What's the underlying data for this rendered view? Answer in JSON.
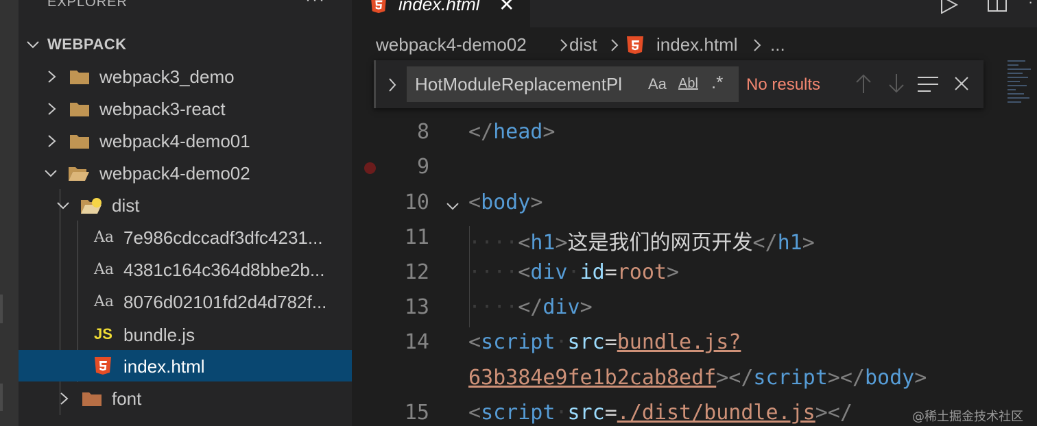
{
  "sidebar": {
    "title": "EXPLORER",
    "more": "···",
    "section": "WEBPACK",
    "items": [
      {
        "label": "webpack3_demo"
      },
      {
        "label": "webpack3-react"
      },
      {
        "label": "webpack4-demo01"
      },
      {
        "label": "webpack4-demo02"
      },
      {
        "label": "dist"
      },
      {
        "label": "7e986cdccadf3dfc4231..."
      },
      {
        "label": "4381c164c364d8bbe2b..."
      },
      {
        "label": "8076d02101fd2d4d782f..."
      },
      {
        "label": "bundle.js"
      },
      {
        "label": "index.html"
      },
      {
        "label": "font"
      }
    ],
    "font_icon_text": "Aa",
    "js_icon_text": "JS"
  },
  "editor": {
    "tab": {
      "label": "index.html",
      "close": "✕"
    },
    "breadcrumb": [
      "webpack4-demo02",
      "dist",
      "index.html",
      "..."
    ],
    "find": {
      "query": "HotModuleReplacementPl",
      "match_case": "Aa",
      "whole_word": "Abl",
      "regex": ".*",
      "status": "No results"
    },
    "lines": [
      {
        "n": "8",
        "tokens": [
          [
            "pun",
            "</"
          ],
          [
            "tag",
            "head"
          ],
          [
            "pun",
            ">"
          ]
        ]
      },
      {
        "n": "9",
        "tokens": []
      },
      {
        "n": "10",
        "tokens": [
          [
            "pun",
            "<"
          ],
          [
            "tag",
            "body"
          ],
          [
            "pun",
            ">"
          ]
        ]
      },
      {
        "n": "11",
        "tokens": [
          [
            "ws",
            "····"
          ],
          [
            "pun",
            "<"
          ],
          [
            "tag",
            "h1"
          ],
          [
            "pun",
            ">"
          ],
          [
            "txt",
            "这是我们的网页开发"
          ],
          [
            "pun",
            "</"
          ],
          [
            "tag",
            "h1"
          ],
          [
            "pun",
            ">"
          ]
        ]
      },
      {
        "n": "12",
        "tokens": [
          [
            "ws",
            "····"
          ],
          [
            "pun",
            "<"
          ],
          [
            "tag",
            "div"
          ],
          [
            "ws",
            "·"
          ],
          [
            "attr",
            "id"
          ],
          [
            "txt",
            "="
          ],
          [
            "str",
            "root"
          ],
          [
            "pun",
            ">"
          ]
        ]
      },
      {
        "n": "13",
        "tokens": [
          [
            "ws",
            "····"
          ],
          [
            "pun",
            "</"
          ],
          [
            "tag",
            "div"
          ],
          [
            "pun",
            ">"
          ]
        ]
      },
      {
        "n": "14",
        "tokens": [
          [
            "pun",
            "<"
          ],
          [
            "tag",
            "script"
          ],
          [
            "ws",
            "·"
          ],
          [
            "attr",
            "src"
          ],
          [
            "txt",
            "="
          ],
          [
            "strul",
            "bundle.js?"
          ]
        ]
      },
      {
        "n": "",
        "tokens": [
          [
            "strul",
            "63b384e9fe1b2cab8edf"
          ],
          [
            "pun",
            "></"
          ],
          [
            "tag",
            "script"
          ],
          [
            "pun",
            "></"
          ],
          [
            "tag",
            "body"
          ],
          [
            "pun",
            ">"
          ]
        ]
      },
      {
        "n": "15",
        "tokens": [
          [
            "pun",
            "<"
          ],
          [
            "tag",
            "script"
          ],
          [
            "ws",
            "·"
          ],
          [
            "attr",
            "src"
          ],
          [
            "txt",
            "="
          ],
          [
            "strul",
            "./dist/bundle.js"
          ],
          [
            "pun",
            "></"
          ]
        ]
      }
    ]
  },
  "watermark": "@稀土掘金技术社区"
}
